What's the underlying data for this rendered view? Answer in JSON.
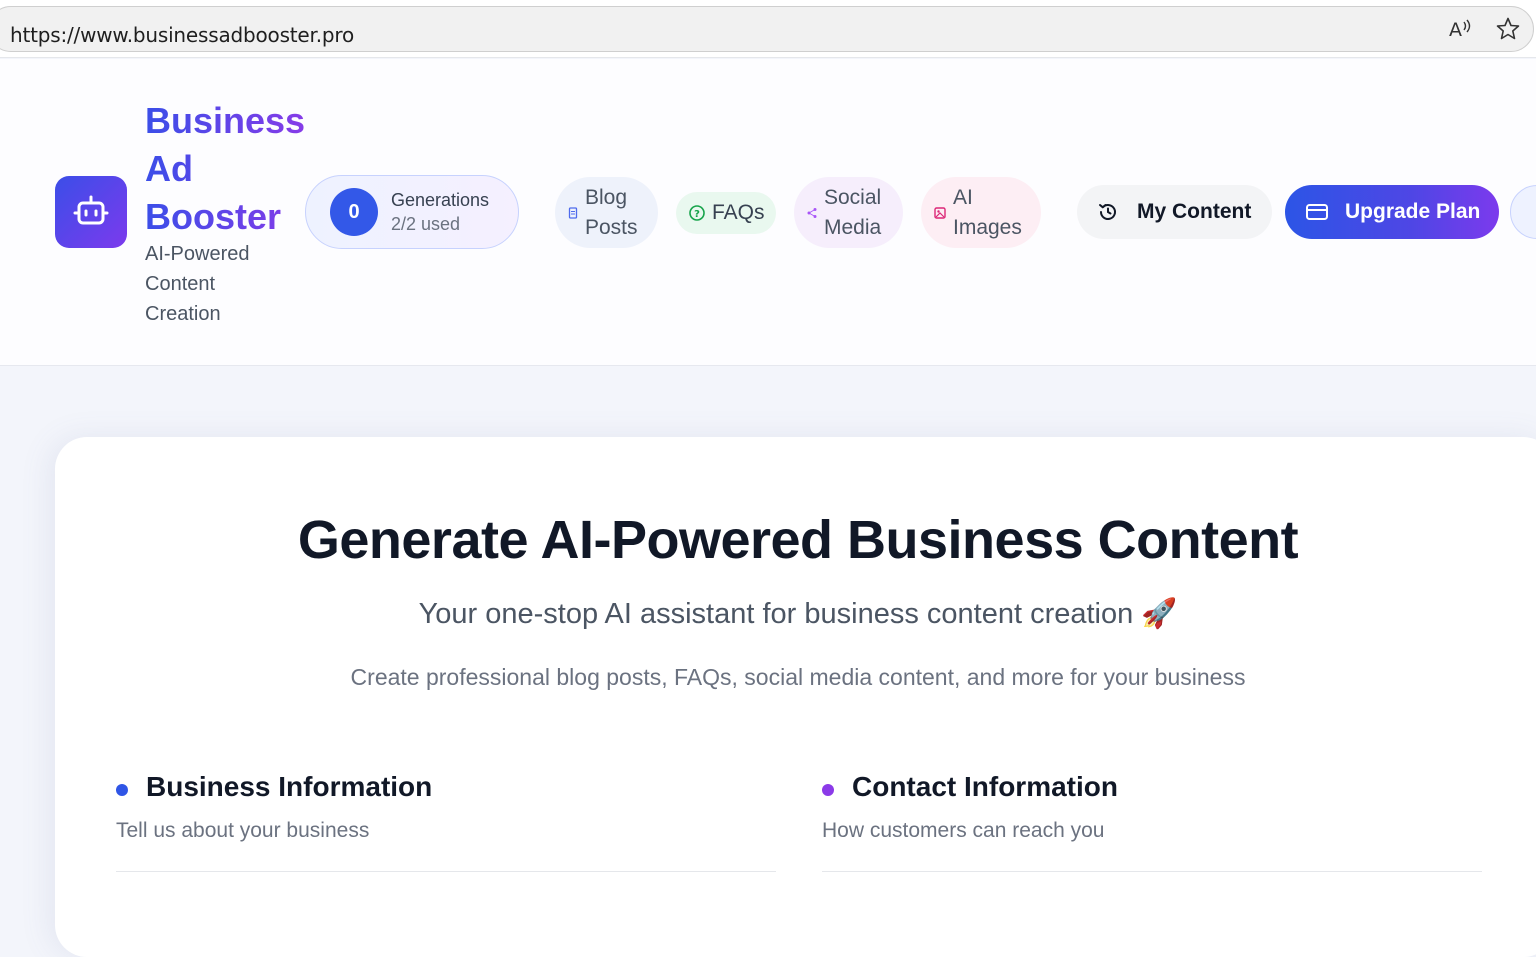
{
  "browser": {
    "url": "https://www.businessadbooster.pro",
    "icons": [
      "read-aloud-icon",
      "favorite-star-icon"
    ]
  },
  "header": {
    "brand": {
      "name_line1": "Business",
      "name_line2": "Ad",
      "name_line3": "Booster",
      "tagline": "AI-Powered Content Creation",
      "icon": "robot-icon"
    },
    "generations": {
      "count": "0",
      "title": "Generations",
      "used": "2/2 used"
    },
    "nav": {
      "blog": "Blog Posts",
      "faqs": "FAQs",
      "social": "Social Media",
      "ai_images": "AI Images"
    },
    "my_content": "My Content",
    "upgrade": "Upgrade Plan"
  },
  "hero": {
    "title": "Generate AI-Powered Business Content",
    "subtitle": "Your one-stop AI assistant for business content creation 🚀",
    "description": "Create professional blog posts, FAQs, social media content, and more for your business"
  },
  "sections": {
    "business": {
      "title": "Business Information",
      "subtitle": "Tell us about your business"
    },
    "contact": {
      "title": "Contact Information",
      "subtitle": "How customers can reach you"
    }
  },
  "colors": {
    "primary": "#3358e8",
    "purple": "#7c3aed",
    "business_dot": "#2f55e6",
    "contact_dot": "#8b3ae8"
  }
}
